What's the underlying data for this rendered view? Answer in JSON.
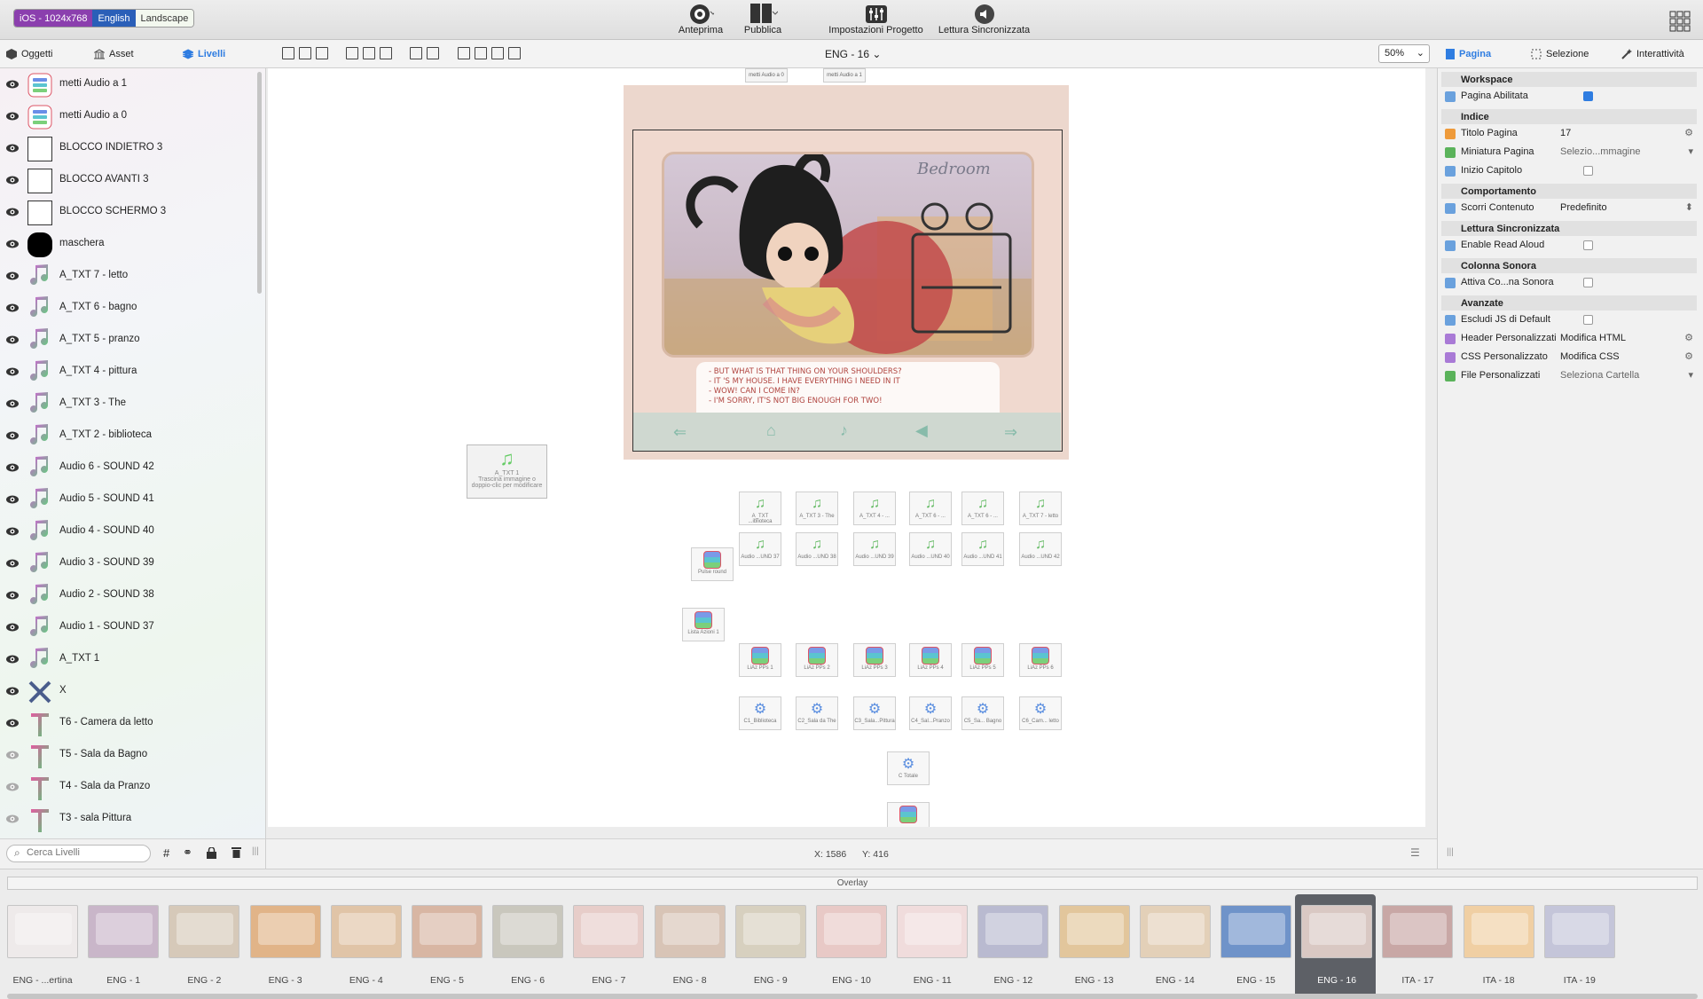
{
  "toolbar": {
    "device": "iOS - 1024x768",
    "language": "English",
    "orientation": "Landscape",
    "preview": "Anteprima",
    "publish": "Pubblica",
    "project_settings": "Impostazioni Progetto",
    "sync_reading": "Lettura Sincronizzata"
  },
  "left_tabs": {
    "objects": "Oggetti",
    "assets": "Asset",
    "layers": "Livelli"
  },
  "page_selector": "ENG - 16",
  "zoom": "50%",
  "right_tabs": {
    "page": "Pagina",
    "selection": "Selezione",
    "interactivity": "Interattività"
  },
  "layers": [
    {
      "label": "metti Audio a 1",
      "type": "list",
      "visible": true
    },
    {
      "label": "metti Audio a 0",
      "type": "list",
      "visible": true
    },
    {
      "label": "BLOCCO INDIETRO 3",
      "type": "box",
      "visible": true
    },
    {
      "label": "BLOCCO AVANTI 3",
      "type": "box",
      "visible": true
    },
    {
      "label": "BLOCCO SCHERMO 3",
      "type": "box",
      "visible": true
    },
    {
      "label": "maschera",
      "type": "mask",
      "visible": true
    },
    {
      "label": "A_TXT 7 - letto",
      "type": "audio",
      "visible": true
    },
    {
      "label": "A_TXT 6 - bagno",
      "type": "audio",
      "visible": true
    },
    {
      "label": "A_TXT 5 - pranzo",
      "type": "audio",
      "visible": true
    },
    {
      "label": "A_TXT 4 - pittura",
      "type": "audio",
      "visible": true
    },
    {
      "label": "A_TXT 3 - The",
      "type": "audio",
      "visible": true
    },
    {
      "label": "A_TXT 2 - biblioteca",
      "type": "audio",
      "visible": true
    },
    {
      "label": "Audio 6 - SOUND 42",
      "type": "audio",
      "visible": true
    },
    {
      "label": "Audio 5 - SOUND 41",
      "type": "audio",
      "visible": true
    },
    {
      "label": "Audio 4 - SOUND 40",
      "type": "audio",
      "visible": true
    },
    {
      "label": "Audio 3 - SOUND 39",
      "type": "audio",
      "visible": true
    },
    {
      "label": "Audio 2 - SOUND 38",
      "type": "audio",
      "visible": true
    },
    {
      "label": "Audio 1 - SOUND 37",
      "type": "audio",
      "visible": true
    },
    {
      "label": "A_TXT 1",
      "type": "audio",
      "visible": true
    },
    {
      "label": "X",
      "type": "image",
      "visible": true
    },
    {
      "label": "T6 - Camera da letto",
      "type": "text",
      "visible": true
    },
    {
      "label": "T5 - Sala da Bagno",
      "type": "text",
      "visible": false
    },
    {
      "label": "T4 - Sala da Pranzo",
      "type": "text",
      "visible": false
    },
    {
      "label": "T3 - sala Pittura",
      "type": "text",
      "visible": false
    }
  ],
  "search_placeholder": "Cerca Livelli",
  "coords": {
    "x": "X: 1586",
    "y": "Y: 416"
  },
  "page_preview": {
    "room_title": "Bedroom",
    "story_lines": [
      "- BUT WHAT IS THAT THING ON YOUR SHOULDERS?",
      "- IT 'S MY HOUSE. I HAVE EVERYTHING I NEED IN IT",
      "- WOW! CAN I COME IN?",
      "- I'M SORRY, IT'S NOT BIG ENOUGH FOR TWO!"
    ],
    "top_nodes": [
      "metti Audio a 0",
      "metti Audio a 1"
    ]
  },
  "canvas_nodes": {
    "a_txt1": {
      "label": "A_TXT 1",
      "hint": "Trascina immagine o doppio-clic per modificare"
    },
    "row1": [
      "A_TXT ...iblioteca",
      "A_TXT 3 - The",
      "A_TXT 4 - ...",
      "A_TXT 6 - ...",
      "A_TXT 6 - ...",
      "A_TXT 7 - letto"
    ],
    "row2": [
      "Audio ...UND 37",
      "Audio ...UND 38",
      "Audio ...UND 39",
      "Audio ...UND 40",
      "Audio ...UND 41",
      "Audio ...UND 42"
    ],
    "pulse": "Pulse round",
    "lista": "Lista Azioni 1",
    "row3": [
      "LiAz PPs 1",
      "LiAz PPs 2",
      "LiAz PPs 3",
      "LiAz PPs 4",
      "LiAz PPs 5",
      "LiAz PPs 6"
    ],
    "row4": [
      "C1_Biblioteca",
      "C2_Sala da The",
      "C3_Sala...Pittura",
      "C4_Sal...Pranzo",
      "C5_Sa... Bagno",
      "C6_Cam... letto"
    ],
    "total": "C Totale"
  },
  "properties": {
    "workspace": "Workspace",
    "page_enabled": "Pagina Abilitata",
    "index": "Indice",
    "page_title_lbl": "Titolo Pagina",
    "page_title_val": "17",
    "thumbnail_lbl": "Miniatura Pagina",
    "thumbnail_val": "Selezio...mmagine",
    "chapter_start": "Inizio Capitolo",
    "behavior": "Comportamento",
    "scroll_lbl": "Scorri Contenuto",
    "scroll_val": "Predefinito",
    "sync": "Lettura Sincronizzata",
    "read_aloud": "Enable Read Aloud",
    "soundtrack": "Colonna Sonora",
    "soundtrack_lbl": "Attiva Co...na Sonora",
    "advanced": "Avanzate",
    "exclude_js": "Escludi JS di Default",
    "header_lbl": "Header Personalizzati",
    "header_val": "Modifica HTML",
    "css_lbl": "CSS Personalizzato",
    "css_val": "Modifica CSS",
    "files_lbl": "File Personalizzati",
    "files_val": "Seleziona Cartella"
  },
  "overlay_label": "Overlay",
  "filmstrip": [
    "ENG - ...ertina",
    "ENG - 1",
    "ENG - 2",
    "ENG - 3",
    "ENG - 4",
    "ENG - 5",
    "ENG - 6",
    "ENG - 7",
    "ENG - 8",
    "ENG - 9",
    "ENG - 10",
    "ENG - 11",
    "ENG - 12",
    "ENG - 13",
    "ENG - 14",
    "ENG - 15",
    "ENG - 16",
    "ITA - 17",
    "ITA - 18",
    "ITA - 19"
  ],
  "selected_page": "ENG - 16",
  "colors": {
    "accent": "#2f7de1",
    "device_badge": "#8b3fae",
    "selected_film": "#5d6066"
  }
}
